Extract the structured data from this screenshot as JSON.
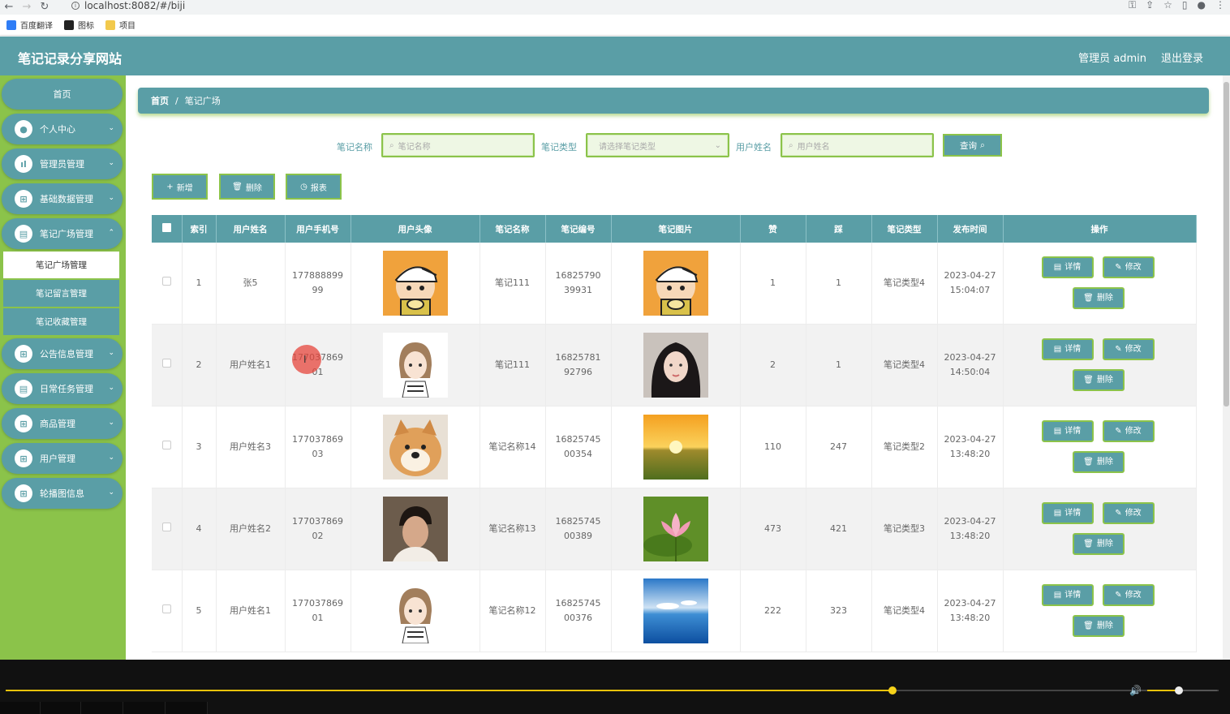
{
  "browser": {
    "url": "localhost:8082/#/biji",
    "bookmarks": [
      "百度翻译",
      "图标",
      "项目"
    ]
  },
  "header": {
    "title": "笔记记录分享网站",
    "admin": "管理员 admin",
    "logout": "退出登录"
  },
  "sidebar": {
    "home": "首页",
    "items": [
      {
        "label": "个人中心"
      },
      {
        "label": "管理员管理"
      },
      {
        "label": "基础数据管理"
      },
      {
        "label": "笔记广场管理"
      },
      {
        "label": "公告信息管理"
      },
      {
        "label": "日常任务管理"
      },
      {
        "label": "商品管理"
      },
      {
        "label": "用户管理"
      },
      {
        "label": "轮播图信息"
      }
    ],
    "sub_items": [
      "笔记广场管理",
      "笔记留言管理",
      "笔记收藏管理"
    ]
  },
  "breadcrumb": {
    "home": "首页",
    "sep": "/",
    "current": "笔记广场"
  },
  "search": {
    "name_label": "笔记名称",
    "name_placeholder": "笔记名称",
    "type_label": "笔记类型",
    "type_placeholder": "请选择笔记类型",
    "user_label": "用户姓名",
    "user_placeholder": "用户姓名",
    "query_btn": "查询"
  },
  "actions": {
    "add": "新增",
    "delete": "删除",
    "report": "报表"
  },
  "table": {
    "headers": [
      "索引",
      "用户姓名",
      "用户手机号",
      "用户头像",
      "笔记名称",
      "笔记编号",
      "笔记图片",
      "赞",
      "踩",
      "笔记类型",
      "发布时间",
      "操作"
    ],
    "rows": [
      {
        "idx": "1",
        "user": "张5",
        "phone": "17788889999",
        "note": "笔记111",
        "no": "1682579039931",
        "likes": "1",
        "dislikes": "1",
        "type": "笔记类型4",
        "date": "2023-04-27",
        "time": "15:04:07",
        "avatar": "cartoon-boy",
        "image": "cartoon-boy"
      },
      {
        "idx": "2",
        "user": "用户姓名1",
        "phone": "17703786901",
        "note": "笔记111",
        "no": "1682578192796",
        "likes": "2",
        "dislikes": "1",
        "type": "笔记类型4",
        "date": "2023-04-27",
        "time": "14:50:04",
        "avatar": "cartoon-girl",
        "image": "girl-photo"
      },
      {
        "idx": "3",
        "user": "用户姓名3",
        "phone": "17703786903",
        "note": "笔记名称14",
        "no": "1682574500354",
        "likes": "110",
        "dislikes": "247",
        "type": "笔记类型2",
        "date": "2023-04-27",
        "time": "13:48:20",
        "avatar": "shiba-dog",
        "image": "sunset-field"
      },
      {
        "idx": "4",
        "user": "用户姓名2",
        "phone": "17703786902",
        "note": "笔记名称13",
        "no": "1682574500389",
        "likes": "473",
        "dislikes": "421",
        "type": "笔记类型3",
        "date": "2023-04-27",
        "time": "13:48:20",
        "avatar": "boy-photo",
        "image": "lotus-flower"
      },
      {
        "idx": "5",
        "user": "用户姓名1",
        "phone": "17703786901",
        "note": "笔记名称12",
        "no": "1682574500376",
        "likes": "222",
        "dislikes": "323",
        "type": "笔记类型4",
        "date": "2023-04-27",
        "time": "13:48:20",
        "avatar": "cartoon-girl",
        "image": "sea-sky"
      }
    ],
    "op_detail": "详情",
    "op_edit": "修改",
    "op_delete": "删除"
  },
  "player": {
    "progress": 0.731,
    "volume": 0.45
  },
  "colors": {
    "primary": "#5a9ea6",
    "accent": "#8bc34a",
    "progress": "#e8c20b"
  }
}
